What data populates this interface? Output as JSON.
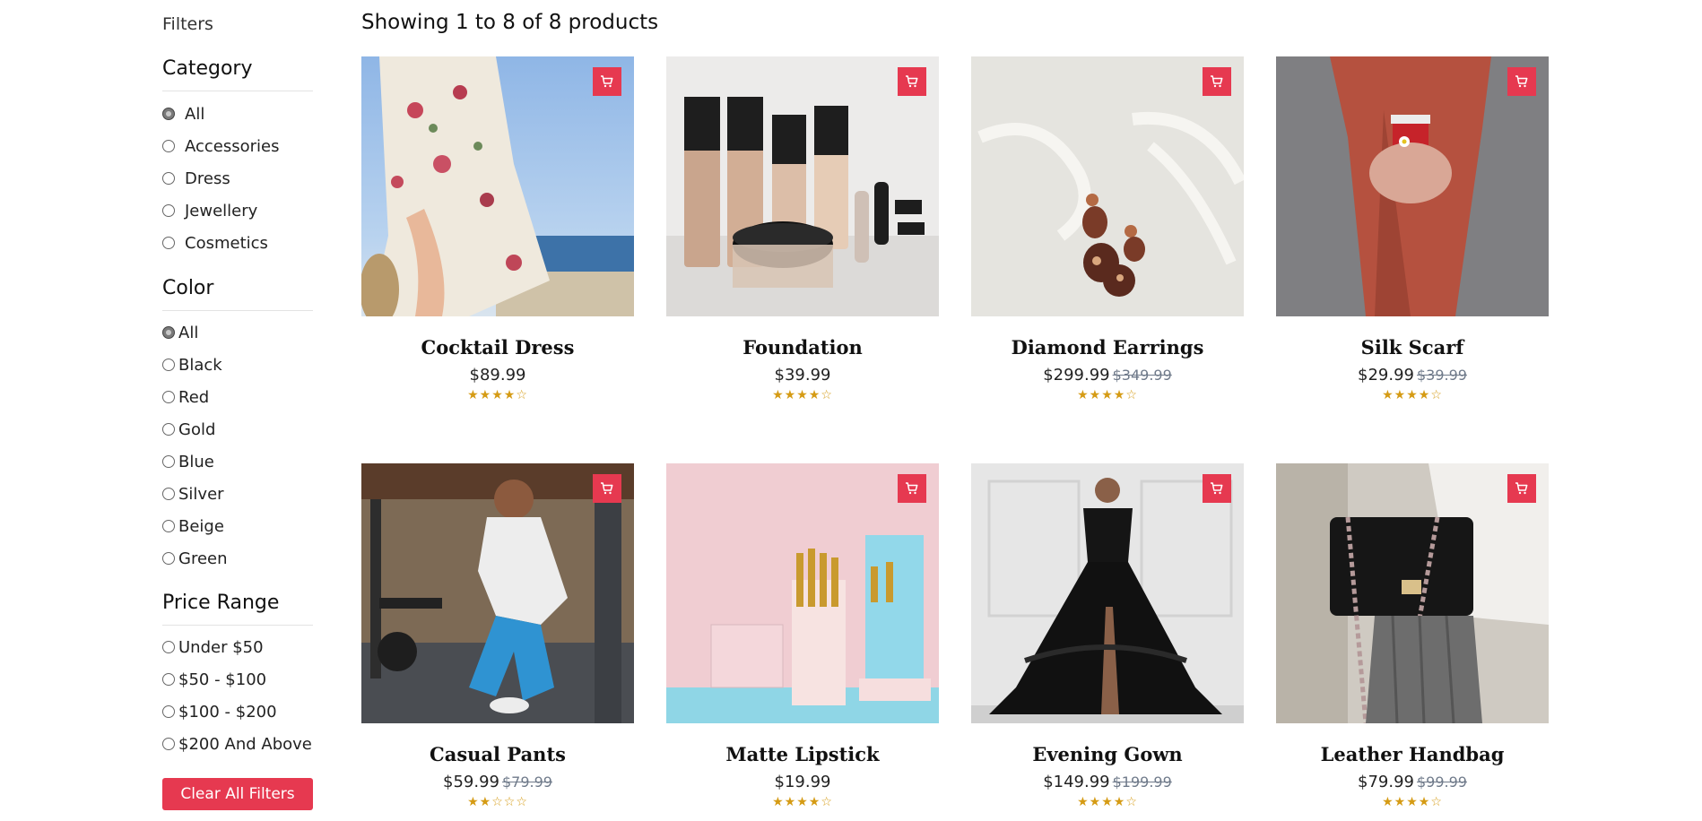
{
  "sidebar": {
    "title": "Filters",
    "category": {
      "title": "Category",
      "options": [
        "All",
        "Accessories",
        "Dress",
        "Jewellery",
        "Cosmetics"
      ],
      "selected": "All"
    },
    "color": {
      "title": "Color",
      "options": [
        "All",
        "Black",
        "Red",
        "Gold",
        "Blue",
        "Silver",
        "Beige",
        "Green"
      ],
      "selected": "All"
    },
    "price_range": {
      "title": "Price Range",
      "options": [
        "Under $50",
        "$50 - $100",
        "$100 - $200",
        "$200 And Above"
      ],
      "selected": null
    },
    "clear_button": "Clear All Filters"
  },
  "main": {
    "showing_text": "Showing 1 to 8 of 8 products"
  },
  "products": [
    {
      "name": "Cocktail Dress",
      "price": "$89.99",
      "old_price": null,
      "rating": 4,
      "icon": "cart-icon"
    },
    {
      "name": "Foundation",
      "price": "$39.99",
      "old_price": null,
      "rating": 4,
      "icon": "cart-icon"
    },
    {
      "name": "Diamond Earrings",
      "price": "$299.99",
      "old_price": "$349.99",
      "rating": 4,
      "icon": "cart-icon"
    },
    {
      "name": "Silk Scarf",
      "price": "$29.99",
      "old_price": "$39.99",
      "rating": 4,
      "icon": "cart-icon"
    },
    {
      "name": "Casual Pants",
      "price": "$59.99",
      "old_price": "$79.99",
      "rating": 2,
      "icon": "cart-icon"
    },
    {
      "name": "Matte Lipstick",
      "price": "$19.99",
      "old_price": null,
      "rating": 4,
      "icon": "cart-icon"
    },
    {
      "name": "Evening Gown",
      "price": "$149.99",
      "old_price": "$199.99",
      "rating": 4,
      "icon": "cart-icon"
    },
    {
      "name": "Leather Handbag",
      "price": "$79.99",
      "old_price": "$99.99",
      "rating": 4,
      "icon": "cart-icon"
    }
  ],
  "colors": {
    "accent": "#e63950",
    "star": "#d59b14",
    "old_price": "#6f7a8a"
  }
}
